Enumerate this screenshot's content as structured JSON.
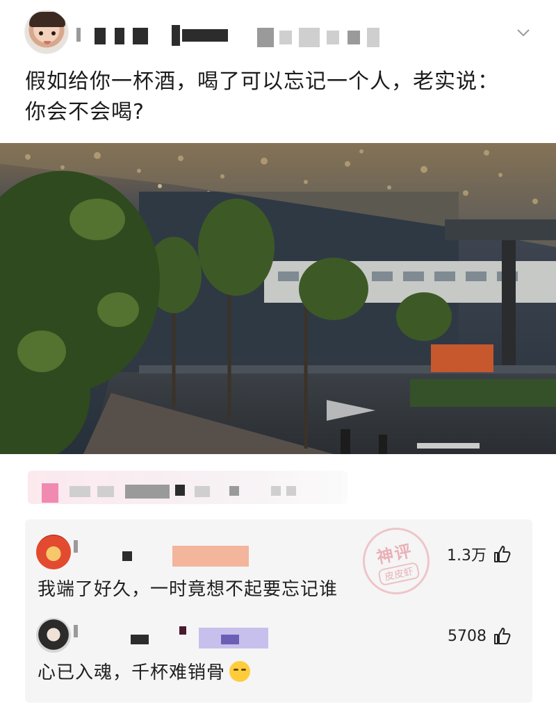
{
  "post": {
    "text_line1": "假如给你一杯酒，喝了可以忘记一个人，老实说：",
    "text_line2": "你会不会喝?",
    "menu_icon": "chevron-down-icon"
  },
  "photo": {
    "description_icon": "photo",
    "colors": {
      "sky": "#2b3440",
      "foliage": "#2f4a1e",
      "lights": "#e9c98a"
    }
  },
  "watermark": {
    "line1": "神评",
    "line2": "皮皮虾"
  },
  "comments": [
    {
      "text": "我端了好久，一时竟想不起要忘记谁",
      "likes": "1.3万",
      "like_icon": "thumbs-up-icon"
    },
    {
      "text": "心已入魂，千杯难销骨",
      "likes": "5708",
      "like_icon": "thumbs-up-icon"
    }
  ]
}
